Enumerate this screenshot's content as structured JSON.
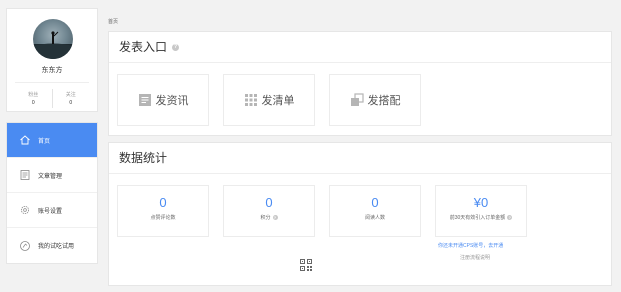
{
  "profile": {
    "username": "东东方",
    "fans_label": "粉丝",
    "fans_value": "0",
    "follow_label": "关注",
    "follow_value": "0"
  },
  "nav": {
    "items": [
      {
        "label": "首页",
        "icon": "home-icon",
        "active": true
      },
      {
        "label": "文章管理",
        "icon": "document-icon",
        "active": false
      },
      {
        "label": "账号设置",
        "icon": "gear-icon",
        "active": false
      },
      {
        "label": "我的试吃试用",
        "icon": "trial-icon",
        "active": false
      }
    ]
  },
  "breadcrumb": "首页",
  "publish": {
    "title": "发表入口",
    "help": "?",
    "cards": [
      {
        "label": "发资讯",
        "icon": "article-icon"
      },
      {
        "label": "发清单",
        "icon": "grid-list-icon"
      },
      {
        "label": "发搭配",
        "icon": "combo-icon"
      }
    ]
  },
  "stats": {
    "title": "数据统计",
    "cards": [
      {
        "value": "0",
        "caption": "点赞评论数",
        "help": false
      },
      {
        "value": "0",
        "caption": "积分",
        "help": true
      },
      {
        "value": "0",
        "caption": "阅读人数",
        "help": false
      },
      {
        "value": "¥0",
        "caption": "前30天有效引入订单金额",
        "help": true
      }
    ],
    "cps_link": "你还未开通CPS账号，去开通",
    "cps_rule": "注册流程说明"
  },
  "colors": {
    "accent": "#4a8bf2",
    "background": "#f2f2f2"
  }
}
